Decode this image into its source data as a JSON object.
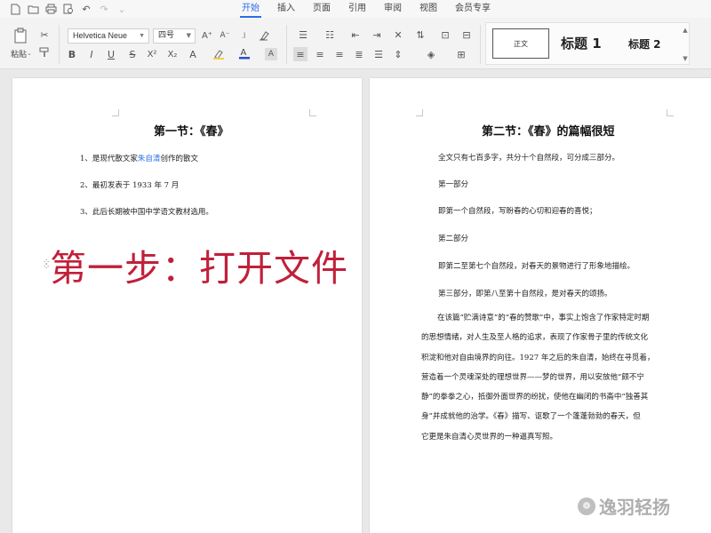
{
  "menubar": {
    "tabs": [
      {
        "label": "开始",
        "active": true
      },
      {
        "label": "插入",
        "active": false
      },
      {
        "label": "页面",
        "active": false
      },
      {
        "label": "引用",
        "active": false
      },
      {
        "label": "审阅",
        "active": false
      },
      {
        "label": "视图",
        "active": false
      },
      {
        "label": "会员专享",
        "active": false
      }
    ]
  },
  "ribbon": {
    "paste_label": "粘贴",
    "font_name": "Helvetica Neue",
    "font_size": "四号",
    "styles": {
      "normal": "正文",
      "heading1": "标题 1",
      "heading2": "标题 2"
    }
  },
  "left_page": {
    "title": "第一节：《春》",
    "items": {
      "item1_prefix": "1、是现代散文家",
      "item1_name": "朱自清",
      "item1_suffix": "创作的散文",
      "item2": "2、最初发表于 1933 年 7 月",
      "item3": "3、此后长期被中国中学语文教材选用。"
    }
  },
  "right_page": {
    "title": "第二节：《春》的篇幅很短",
    "lines": [
      "全文只有七百多字，共分十个自然段，可分成三部分。",
      "第一部分",
      "即第一个自然段，写盼春的心切和迎春的喜悦；",
      "第二部分",
      "即第二至第七个自然段，对春天的景物进行了形象地描绘。",
      "第三部分，即第八至第十自然段，是对春天的颂扬。"
    ],
    "paragraph": [
      "在该篇“贮满诗意”的“春的赞歌”中，事实上饱含了作家特定时期",
      "的思想情绪，对人生及至人格的追求，表现了作家骨子里的传统文化",
      "积淀和他对自由境界的向往。1927 年之后的朱自清，始终在寻觅着，",
      "营造着一个灵魂深处的理想世界——梦的世界，用以安放他“颇不宁",
      "静”的拳拳之心，抵御外面世界的纷扰，使他在幽闭的书斋中“独善其",
      "身”并成就他的治学。《春》描写、讴歌了一个蓬蓬勃勃的春天，但",
      "它更是朱自清心灵世界的一种逼真写照。"
    ]
  },
  "overlay": {
    "step_text": "第一步：打开文件"
  },
  "watermark": {
    "text": "逸羽轻扬"
  },
  "colors": {
    "accent": "#2b6de8",
    "overlay_red": "#c0203a"
  }
}
